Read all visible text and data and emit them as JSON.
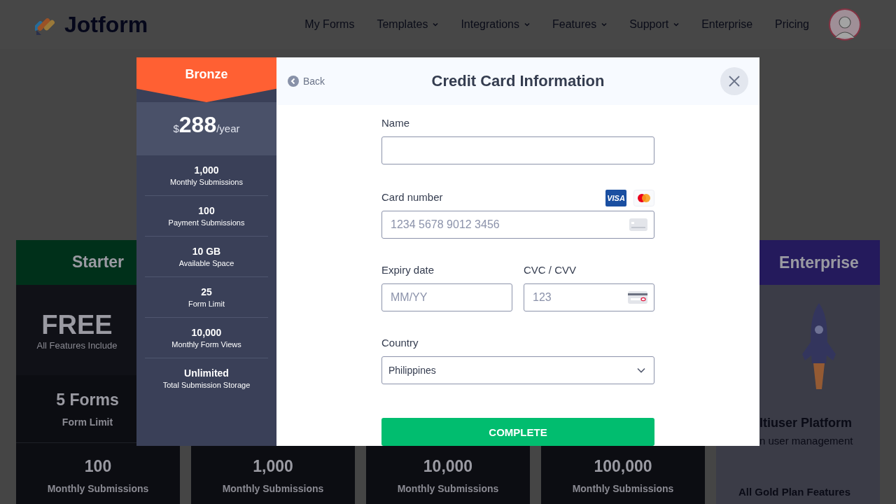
{
  "header": {
    "logo_text": "Jotform",
    "nav": [
      {
        "label": "My Forms",
        "dropdown": false
      },
      {
        "label": "Templates",
        "dropdown": true
      },
      {
        "label": "Integrations",
        "dropdown": true
      },
      {
        "label": "Features",
        "dropdown": true
      },
      {
        "label": "Support",
        "dropdown": true
      },
      {
        "label": "Enterprise",
        "dropdown": false
      },
      {
        "label": "Pricing",
        "dropdown": false
      }
    ]
  },
  "plans": [
    {
      "kind": "starter",
      "name": "Starter",
      "price": "FREE",
      "price_note": "All Features Include",
      "limit": "5 Forms",
      "limit_label": "Form Limit",
      "submissions": "100",
      "submissions_label": "Monthly Submissions"
    },
    {
      "kind": "covered",
      "submissions": "1,000",
      "submissions_label": "Monthly Submissions"
    },
    {
      "kind": "covered",
      "submissions": "10,000",
      "submissions_label": "Monthly Submissions"
    },
    {
      "kind": "covered",
      "submissions": "100,000",
      "submissions_label": "Monthly Submissions"
    },
    {
      "kind": "enterprise",
      "name": "Enterprise",
      "feature_title": "ltiuser Platform",
      "feature_note": "n user management",
      "footer": "All Gold Plan Features"
    }
  ],
  "modal": {
    "plan": {
      "name": "Bronze",
      "currency": "$",
      "price": "288",
      "period": "/year",
      "features": [
        {
          "value": "1,000",
          "label": "Monthly Submissions"
        },
        {
          "value": "100",
          "label": "Payment Submissions"
        },
        {
          "value": "10 GB",
          "label": "Available Space"
        },
        {
          "value": "25",
          "label": "Form Limit"
        },
        {
          "value": "10,000",
          "label": "Monthly Form Views"
        },
        {
          "value": "Unlimited",
          "label": "Total Submission Storage"
        }
      ]
    },
    "back": "Back",
    "title": "Credit Card Information",
    "name_label": "Name",
    "card_label": "Card number",
    "card_placeholder": "1234 5678 9012 3456",
    "visa_text": "VISA",
    "expiry_label": "Expiry date",
    "expiry_placeholder": "MM/YY",
    "cvc_label": "CVC / CVV",
    "cvc_placeholder": "123",
    "country_label": "Country",
    "country_value": "Philippines",
    "submit": "COMPLETE"
  }
}
